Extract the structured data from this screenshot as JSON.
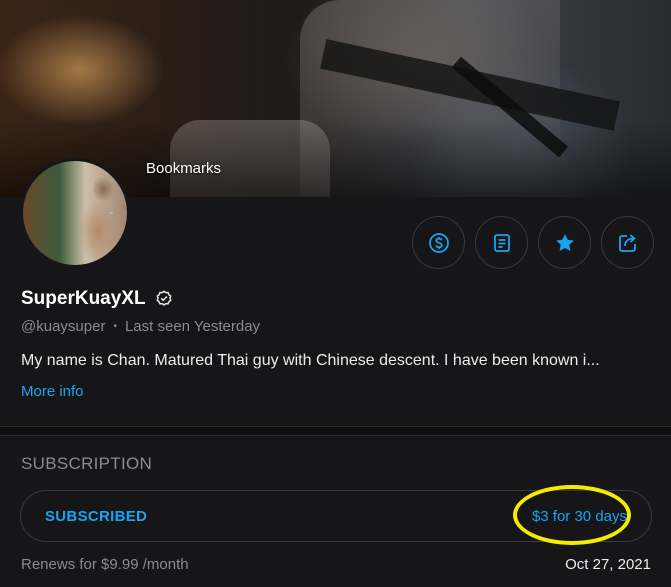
{
  "cover": {
    "label": "Bookmarks"
  },
  "profile": {
    "name": "SuperKuayXL",
    "handle": "@kuaysuper",
    "last_seen": "Last seen Yesterday",
    "bio": "My name is Chan. Matured Thai guy with Chinese descent. I have been known i...",
    "more_info": "More info"
  },
  "actions": [
    {
      "name": "tip-button",
      "icon": "dollar-circle-icon"
    },
    {
      "name": "message-button",
      "icon": "message-icon"
    },
    {
      "name": "favorite-button",
      "icon": "star-icon"
    },
    {
      "name": "share-button",
      "icon": "share-icon"
    }
  ],
  "subscription": {
    "title": "SUBSCRIPTION",
    "status": "SUBSCRIBED",
    "price": "$3 for 30 days",
    "renews": "Renews for $9.99 /month",
    "renew_date": "Oct 27, 2021"
  },
  "colors": {
    "accent": "#1aa3f0",
    "highlight": "#f3ec00",
    "background": "#161618"
  }
}
